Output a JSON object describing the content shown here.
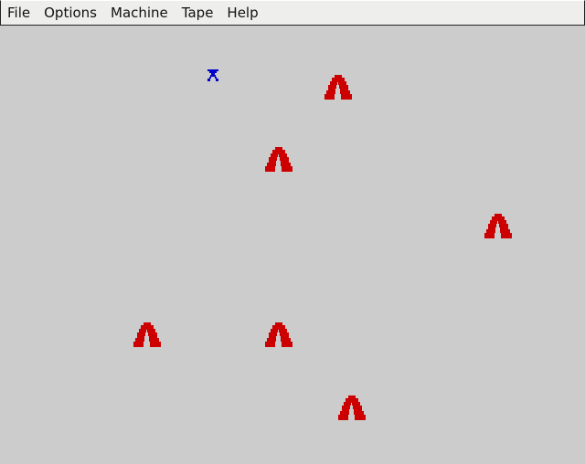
{
  "menubar": {
    "items": [
      "File",
      "Options",
      "Machine",
      "Tape",
      "Help"
    ]
  },
  "screen": {
    "background_color": "#cccccc",
    "mountain_color": "#cc0000",
    "ship_color": "#0000cc",
    "player": {
      "icon": "ship-icon"
    },
    "obstacles": [
      {
        "icon": "mountain-icon"
      },
      {
        "icon": "mountain-icon"
      },
      {
        "icon": "mountain-icon"
      },
      {
        "icon": "mountain-icon"
      },
      {
        "icon": "mountain-icon"
      },
      {
        "icon": "mountain-icon"
      }
    ]
  }
}
